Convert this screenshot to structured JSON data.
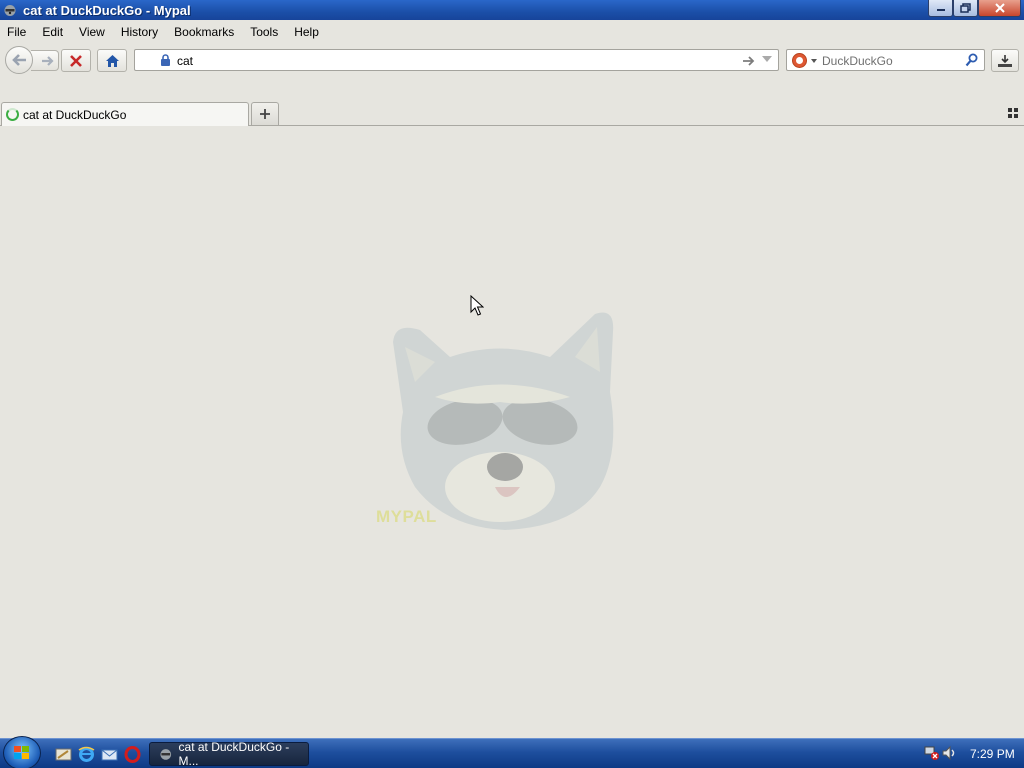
{
  "window": {
    "title": "cat at DuckDuckGo - Mypal",
    "controls": {
      "minimize": "",
      "restore": "",
      "close": ""
    }
  },
  "menu": {
    "items": [
      {
        "label": "File"
      },
      {
        "label": "Edit"
      },
      {
        "label": "View"
      },
      {
        "label": "History"
      },
      {
        "label": "Bookmarks"
      },
      {
        "label": "Tools"
      },
      {
        "label": "Help"
      }
    ]
  },
  "navbar": {
    "url_value": "cat",
    "search_placeholder": "DuckDuckGo",
    "icons": {
      "back": "back-arrow-icon",
      "forward": "forward-arrow-icon",
      "stop": "stop-icon",
      "home": "home-icon",
      "lock": "lock-icon",
      "go": "go-arrow-icon",
      "search": "magnifier-icon",
      "downloads": "downloads-icon"
    }
  },
  "tabs": [
    {
      "label": "cat at DuckDuckGo",
      "loading": true
    }
  ],
  "content": {
    "watermark_text": "MYPAL"
  },
  "taskbar": {
    "task_label": "cat at DuckDuckGo - M...",
    "clock": "7:29 PM",
    "quicklaunch": [
      "show-desktop-icon",
      "internet-explorer-icon",
      "mail-icon",
      "opera-icon"
    ]
  },
  "colors": {
    "titlebar": "#1b4fa8",
    "background": "#e6e5df",
    "taskbar": "#1e4f9e",
    "loading_spinner": "#3cae43",
    "duckduckgo": "#de5833"
  }
}
